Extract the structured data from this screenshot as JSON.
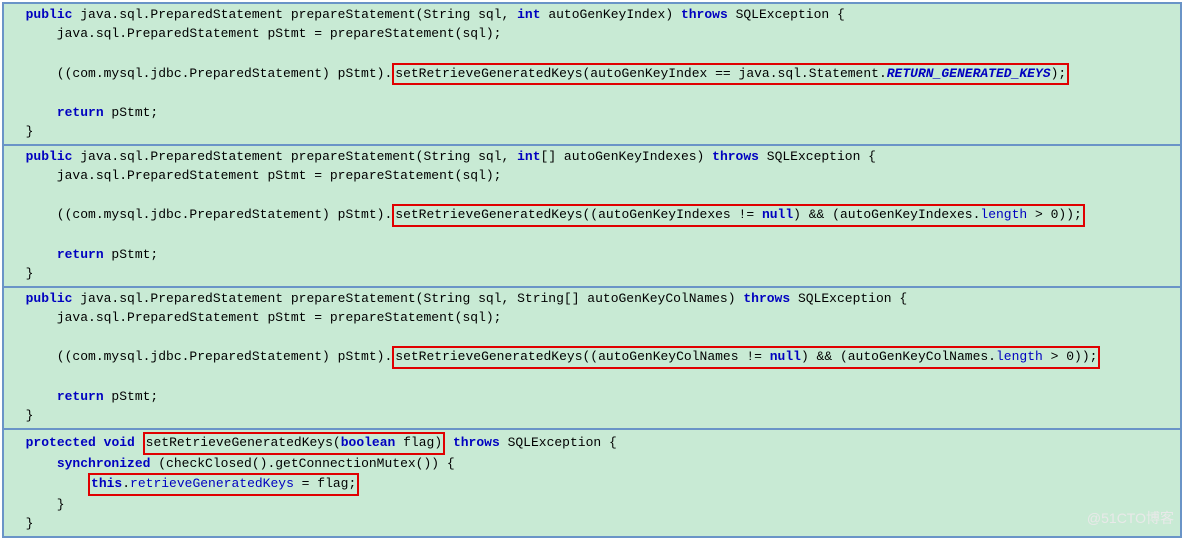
{
  "watermark": "@51CTO博客",
  "blocks": [
    {
      "lines": [
        {
          "indent": 1,
          "tokens": [
            {
              "t": "kw",
              "v": "public"
            },
            {
              "t": "sp"
            },
            {
              "t": "txt",
              "v": "java.sql.PreparedStatement prepareStatement(String sql, "
            },
            {
              "t": "kw",
              "v": "int"
            },
            {
              "t": "txt",
              "v": " autoGenKeyIndex) "
            },
            {
              "t": "kw",
              "v": "throws"
            },
            {
              "t": "txt",
              "v": " SQLException {"
            }
          ]
        },
        {
          "indent": 3,
          "tokens": [
            {
              "t": "txt",
              "v": "java.sql.PreparedStatement pStmt = prepareStatement(sql);"
            }
          ]
        },
        {
          "indent": 0,
          "tokens": [
            {
              "t": "blank"
            }
          ]
        },
        {
          "indent": 3,
          "tokens": [
            {
              "t": "txt",
              "v": "((com.mysql.jdbc.PreparedStatement) pStmt)."
            },
            {
              "t": "redbox",
              "inner": [
                {
                  "t": "txt",
                  "v": "setRetrieveGeneratedKeys(autoGenKeyIndex == java.sql.Statement."
                },
                {
                  "t": "staticfield",
                  "v": "RETURN_GENERATED_KEYS"
                },
                {
                  "t": "txt",
                  "v": ");"
                }
              ]
            }
          ]
        },
        {
          "indent": 0,
          "tokens": [
            {
              "t": "blank"
            }
          ]
        },
        {
          "indent": 3,
          "tokens": [
            {
              "t": "kw",
              "v": "return"
            },
            {
              "t": "txt",
              "v": " pStmt;"
            }
          ]
        },
        {
          "indent": 1,
          "tokens": [
            {
              "t": "txt",
              "v": "}"
            }
          ]
        }
      ]
    },
    {
      "lines": [
        {
          "indent": 1,
          "tokens": [
            {
              "t": "kw",
              "v": "public"
            },
            {
              "t": "sp"
            },
            {
              "t": "txt",
              "v": "java.sql.PreparedStatement prepareStatement(String sql, "
            },
            {
              "t": "kw",
              "v": "int"
            },
            {
              "t": "txt",
              "v": "[] autoGenKeyIndexes) "
            },
            {
              "t": "kw",
              "v": "throws"
            },
            {
              "t": "txt",
              "v": " SQLException {"
            }
          ]
        },
        {
          "indent": 3,
          "tokens": [
            {
              "t": "txt",
              "v": "java.sql.PreparedStatement pStmt = prepareStatement(sql);"
            }
          ]
        },
        {
          "indent": 0,
          "tokens": [
            {
              "t": "blank"
            }
          ]
        },
        {
          "indent": 3,
          "tokens": [
            {
              "t": "txt",
              "v": "((com.mysql.jdbc.PreparedStatement) pStmt)."
            },
            {
              "t": "redbox",
              "inner": [
                {
                  "t": "txt",
                  "v": "setRetrieveGeneratedKeys((autoGenKeyIndexes != "
                },
                {
                  "t": "kw",
                  "v": "null"
                },
                {
                  "t": "txt",
                  "v": ") && (autoGenKeyIndexes."
                },
                {
                  "t": "field",
                  "v": "length"
                },
                {
                  "t": "txt",
                  "v": " > 0));"
                }
              ]
            }
          ]
        },
        {
          "indent": 0,
          "tokens": [
            {
              "t": "blank"
            }
          ]
        },
        {
          "indent": 3,
          "tokens": [
            {
              "t": "kw",
              "v": "return"
            },
            {
              "t": "txt",
              "v": " pStmt;"
            }
          ]
        },
        {
          "indent": 1,
          "tokens": [
            {
              "t": "txt",
              "v": "}"
            }
          ]
        }
      ]
    },
    {
      "lines": [
        {
          "indent": 1,
          "tokens": [
            {
              "t": "kw",
              "v": "public"
            },
            {
              "t": "sp"
            },
            {
              "t": "txt",
              "v": "java.sql.PreparedStatement prepareStatement(String sql, String[] autoGenKeyColNames) "
            },
            {
              "t": "kw",
              "v": "throws"
            },
            {
              "t": "txt",
              "v": " SQLException {"
            }
          ]
        },
        {
          "indent": 3,
          "tokens": [
            {
              "t": "txt",
              "v": "java.sql.PreparedStatement pStmt = prepareStatement(sql);"
            }
          ]
        },
        {
          "indent": 0,
          "tokens": [
            {
              "t": "blank"
            }
          ]
        },
        {
          "indent": 3,
          "tokens": [
            {
              "t": "txt",
              "v": "((com.mysql.jdbc.PreparedStatement) pStmt)."
            },
            {
              "t": "redbox",
              "inner": [
                {
                  "t": "txt",
                  "v": "setRetrieveGeneratedKeys((autoGenKeyColNames != "
                },
                {
                  "t": "kw",
                  "v": "null"
                },
                {
                  "t": "txt",
                  "v": ") && (autoGenKeyColNames."
                },
                {
                  "t": "field",
                  "v": "length"
                },
                {
                  "t": "txt",
                  "v": " > 0));"
                }
              ]
            }
          ]
        },
        {
          "indent": 0,
          "tokens": [
            {
              "t": "blank"
            }
          ]
        },
        {
          "indent": 3,
          "tokens": [
            {
              "t": "kw",
              "v": "return"
            },
            {
              "t": "txt",
              "v": " pStmt;"
            }
          ]
        },
        {
          "indent": 1,
          "tokens": [
            {
              "t": "txt",
              "v": "}"
            }
          ]
        }
      ]
    },
    {
      "lines": [
        {
          "indent": 1,
          "tokens": [
            {
              "t": "kw",
              "v": "protected"
            },
            {
              "t": "sp"
            },
            {
              "t": "kw",
              "v": "void"
            },
            {
              "t": "sp"
            },
            {
              "t": "redbox",
              "inner": [
                {
                  "t": "txt",
                  "v": "setRetrieveGeneratedKeys("
                },
                {
                  "t": "kw",
                  "v": "boolean"
                },
                {
                  "t": "txt",
                  "v": " flag)"
                }
              ]
            },
            {
              "t": "sp"
            },
            {
              "t": "kw",
              "v": "throws"
            },
            {
              "t": "txt",
              "v": " SQLException {"
            }
          ]
        },
        {
          "indent": 3,
          "tokens": [
            {
              "t": "kw",
              "v": "synchronized"
            },
            {
              "t": "txt",
              "v": " (checkClosed().getConnectionMutex()) {"
            }
          ]
        },
        {
          "indent": 5,
          "tokens": [
            {
              "t": "redbox",
              "inner": [
                {
                  "t": "kw",
                  "v": "this"
                },
                {
                  "t": "txt",
                  "v": "."
                },
                {
                  "t": "field",
                  "v": "retrieveGeneratedKeys"
                },
                {
                  "t": "txt",
                  "v": " = flag;"
                }
              ]
            }
          ]
        },
        {
          "indent": 3,
          "tokens": [
            {
              "t": "txt",
              "v": "}"
            }
          ]
        },
        {
          "indent": 1,
          "tokens": [
            {
              "t": "txt",
              "v": "}"
            }
          ]
        }
      ]
    }
  ]
}
